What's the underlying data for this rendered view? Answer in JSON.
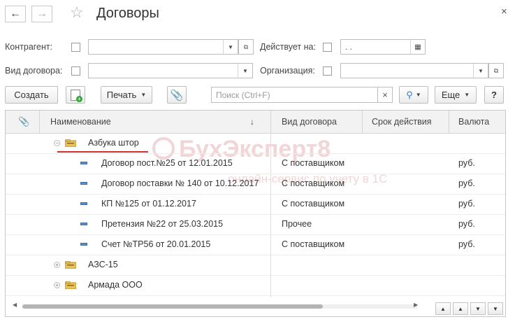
{
  "window": {
    "title": "Договоры",
    "close_glyph": "×"
  },
  "filters": {
    "counterparty_label": "Контрагент:",
    "valid_on_label": "Действует на:",
    "valid_on_value": " .  .",
    "contract_type_label": "Вид договора:",
    "organization_label": "Организация:"
  },
  "toolbar": {
    "create_label": "Создать",
    "print_label": "Печать",
    "search_placeholder": "Поиск (Ctrl+F)",
    "search_clear": "×",
    "more_label": "Еще",
    "help_label": "?"
  },
  "grid": {
    "columns": [
      "Наименование",
      "Вид договора",
      "Срок действия",
      "Валюта"
    ],
    "sort_indicator": "↓",
    "rows": [
      {
        "name": "Азбука штор",
        "type": "",
        "term": "",
        "currency": ""
      },
      {
        "name": "Договор пост.№25 от 12.01.2015",
        "type": "С поставщиком",
        "term": "",
        "currency": "руб."
      },
      {
        "name": "Договор поставки № 140 от 10.12.2017",
        "type": "С поставщиком",
        "term": "",
        "currency": "руб."
      },
      {
        "name": "КП №125 от 01.12.2017",
        "type": "С поставщиком",
        "term": "",
        "currency": "руб."
      },
      {
        "name": "Претензия №22 от 25.03.2015",
        "type": "Прочее",
        "term": "",
        "currency": "руб."
      },
      {
        "name": "Счет №ТР56 от 20.01.2015",
        "type": "С поставщиком",
        "term": "",
        "currency": "руб."
      },
      {
        "name": "АЗС-15",
        "type": "",
        "term": "",
        "currency": ""
      },
      {
        "name": "Армада ООО",
        "type": "",
        "term": "",
        "currency": ""
      }
    ]
  },
  "watermark": {
    "text": "БухЭксперт8",
    "subtext": "онлайн-сервис по учету в 1С"
  },
  "colors": {
    "folder": "#e8c15a",
    "doc_icon": "#5b8fc7",
    "underline": "#d32f2f",
    "add_icon": "#3aa23a"
  }
}
